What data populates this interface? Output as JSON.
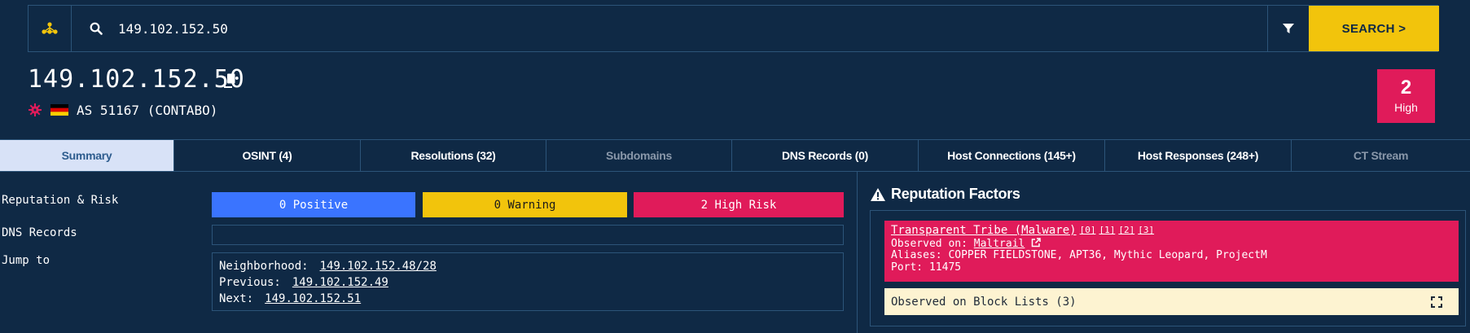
{
  "search": {
    "value": "149.102.152.50",
    "button_label": "SEARCH >"
  },
  "header": {
    "ip": "149.102.152.50",
    "asn": "AS 51167 (CONTABO)",
    "risk_count": "2",
    "risk_label": "High"
  },
  "tabs": [
    {
      "label": "Summary",
      "state": "active"
    },
    {
      "label": "OSINT (4)",
      "state": "normal"
    },
    {
      "label": "Resolutions (32)",
      "state": "normal"
    },
    {
      "label": "Subdomains",
      "state": "disabled"
    },
    {
      "label": "DNS Records (0)",
      "state": "normal"
    },
    {
      "label": "Host Connections (145+)",
      "state": "normal"
    },
    {
      "label": "Host Responses (248+)",
      "state": "normal"
    },
    {
      "label": "CT Stream",
      "state": "disabled"
    }
  ],
  "summary": {
    "reputation_label": "Reputation & Risk",
    "positive": "0 Positive",
    "warning": "0 Warning",
    "high_risk": "2 High Risk",
    "dns_label": "DNS Records",
    "jump_label": "Jump to",
    "neighborhood_label": "Neighborhood:",
    "neighborhood_value": "149.102.152.48/28",
    "previous_label": "Previous:",
    "previous_value": "149.102.152.49",
    "next_label": "Next:",
    "next_value": "149.102.152.51"
  },
  "reputation": {
    "title": "Reputation Factors",
    "malware_name": "Transparent Tribe (Malware)",
    "refs": [
      "[0]",
      "[1]",
      "[2]",
      "[3]"
    ],
    "observed_label": "Observed on:",
    "observed_source": "Maltrail",
    "aliases": "Aliases: COPPER FIELDSTONE, APT36, Mythic Leopard, ProjectM",
    "port": "Port: 11475",
    "blocklists": "Observed on Block Lists (3)"
  },
  "colors": {
    "background": "#0f2945",
    "border": "#2c5479",
    "accent_yellow": "#f2c40c",
    "high_risk": "#e01b5a",
    "positive": "#3a74ff",
    "active_tab": "#d8e2f7"
  }
}
